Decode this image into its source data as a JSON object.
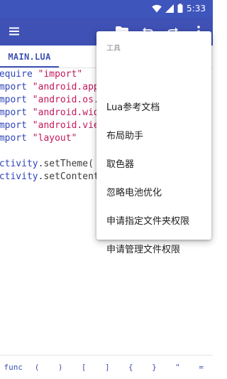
{
  "status_bar": {
    "time": "5:33",
    "icons": [
      "wifi-icon",
      "signal-icon",
      "battery-icon"
    ]
  },
  "app_bar": {
    "icons": [
      "hamburger-menu-icon",
      "folder-icon",
      "undo-icon",
      "redo-icon",
      "more-vert-icon"
    ]
  },
  "tabs": [
    {
      "label": "MAIN.LUA",
      "active": true
    }
  ],
  "editor": {
    "lines": [
      [
        {
          "t": "require ",
          "c": "kw"
        },
        {
          "t": "\"import\"",
          "c": "str"
        }
      ],
      [
        {
          "t": "import ",
          "c": "kw"
        },
        {
          "t": "\"android.app.*\"",
          "c": "str"
        }
      ],
      [
        {
          "t": "import ",
          "c": "kw"
        },
        {
          "t": "\"android.os.*\"",
          "c": "str"
        }
      ],
      [
        {
          "t": "import ",
          "c": "kw"
        },
        {
          "t": "\"android.widget.*\"",
          "c": "str"
        }
      ],
      [
        {
          "t": "import ",
          "c": "kw"
        },
        {
          "t": "\"android.view.*\"",
          "c": "str"
        }
      ],
      [
        {
          "t": "import ",
          "c": "kw"
        },
        {
          "t": "\"layout\"",
          "c": "str"
        }
      ],
      [],
      [
        {
          "t": "activity",
          "c": "kw"
        },
        {
          "t": ".setTheme(",
          "c": "plain"
        }
      ],
      [
        {
          "t": "activity",
          "c": "kw"
        },
        {
          "t": ".setContentView(",
          "c": "plain"
        }
      ]
    ]
  },
  "menu": {
    "header": "工具",
    "items": [
      "Lua参考文档",
      "布局助手",
      "取色器",
      "忽略电池优化",
      "申请指定文件夹权限",
      "申请管理文件权限"
    ]
  },
  "symbol_bar": {
    "symbols": [
      "func",
      "(",
      ")",
      "[",
      "]",
      "{",
      "}",
      "\"",
      "="
    ]
  },
  "colors": {
    "primary": "#3f51b5",
    "status_bar": "#3e55bc",
    "keyword": "#2f46b8",
    "string": "#c2185b"
  }
}
